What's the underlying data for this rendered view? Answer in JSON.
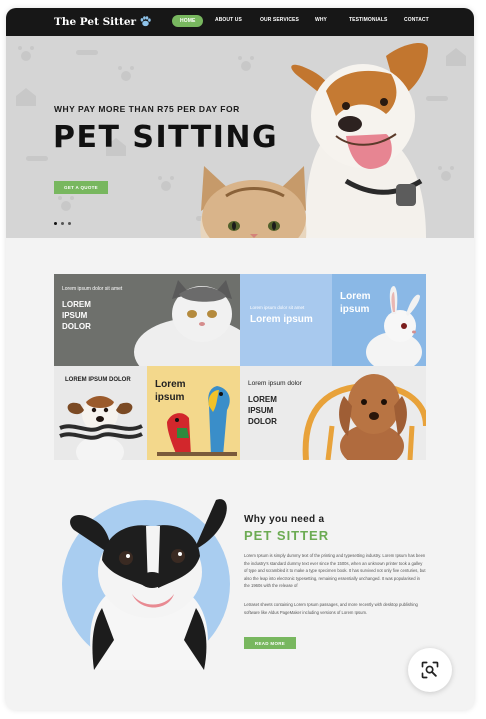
{
  "nav": {
    "logo_text": "The Pet Sitter",
    "logo_icon": "paw-icon",
    "items": [
      "HOME",
      "ABOUT US",
      "OUR SERVICES",
      "WHY",
      "TESTIMONIALS",
      "CONTACT"
    ],
    "active_item": "HOME"
  },
  "hero": {
    "kicker": "WHY PAY MORE THAN R75 PER DAY FOR",
    "title": "PET SITTING",
    "cta_label": "GET A QUOTE",
    "slide_count": 3,
    "active_slide": 1
  },
  "gallery": {
    "tile1": {
      "small": "Lorem ipsum dolor sit amet",
      "big_lines": [
        "LOREM",
        "IPSUM",
        "DOLOR"
      ]
    },
    "tile2": {
      "small": "Lorem ipsum dolor sit amet",
      "big": "Lorem ipsum"
    },
    "tile3": {
      "big_lines": [
        "Lorem",
        "ipsum"
      ]
    },
    "tile4": {
      "heading": "LOREM IPSUM DOLOR"
    },
    "tile5": {
      "big_lines": [
        "Lorem",
        "ipsum"
      ]
    },
    "tile6": {
      "small": "Lorem ipsum dolor",
      "big_lines": [
        "LOREM",
        "IPSUM",
        "DOLOR"
      ]
    }
  },
  "why": {
    "heading": "Why you need a",
    "subheading": "PET SITTER",
    "paragraph1": "Lorem Ipsum is simply dummy text of the printing and typesetting industry. Lorem Ipsum has been the industry's standard dummy text ever since the 1500s, when an unknown printer took a galley of type and scrambled it to make a type specimen book. It has survived not only five centuries, but also the leap into electronic typesetting, remaining essentially unchanged. It was popularised in the 1960s with the release of",
    "paragraph2": "Letraset sheets containing Lorem Ipsum passages, and more recently with desktop publishing software like Aldus PageMaker including versions of Lorem Ipsum.",
    "button_label": "READ MORE"
  },
  "colors": {
    "nav_bg": "#171717",
    "accent_green": "#78b75f",
    "light_blue": "#a8c9ee",
    "yellow": "#f3d88c",
    "circle_blue": "#a9cdf0"
  },
  "lens_button_icon": "image-search-icon"
}
